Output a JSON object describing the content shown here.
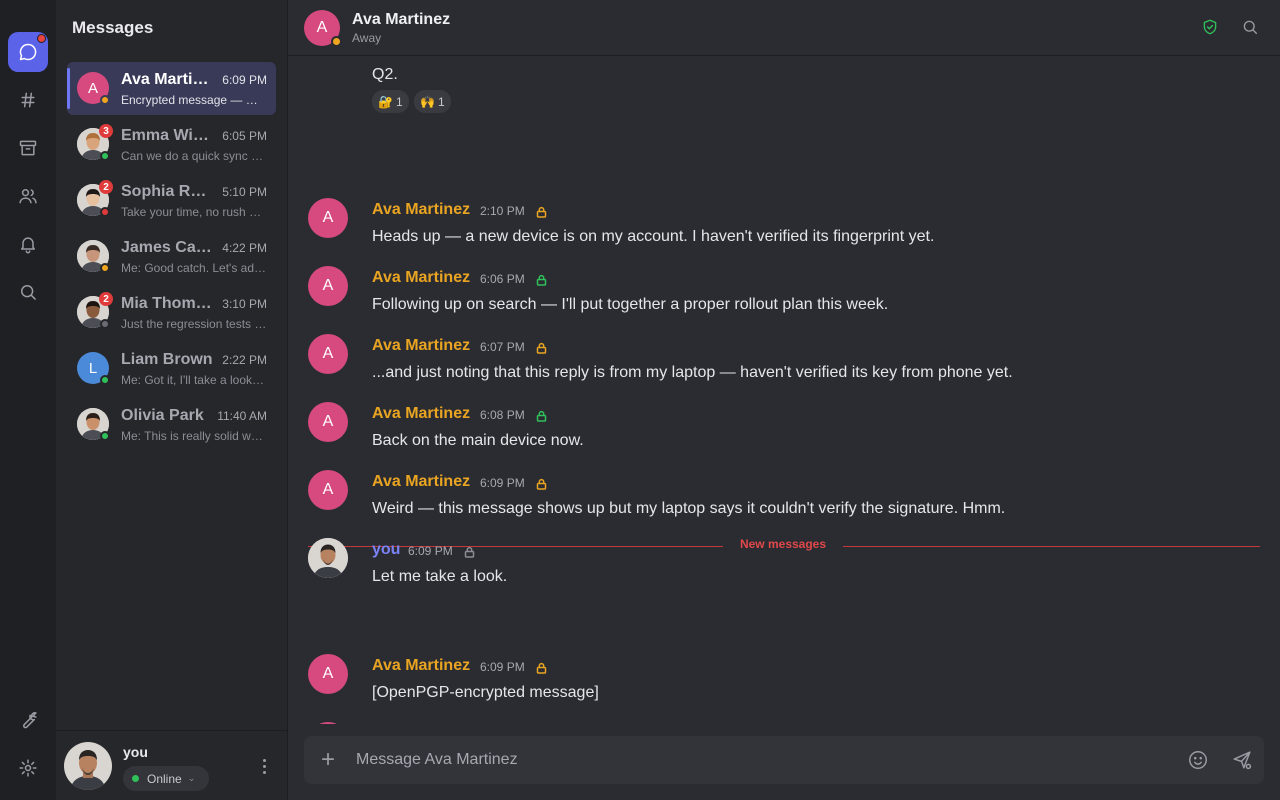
{
  "rail": {
    "items": [
      {
        "icon": "chat-bubble-icon",
        "active": true,
        "has_dot": true
      },
      {
        "icon": "hashtag-icon"
      },
      {
        "icon": "archive-icon"
      },
      {
        "icon": "contacts-icon"
      },
      {
        "icon": "bell-icon"
      },
      {
        "icon": "search-icon"
      }
    ],
    "bottom": [
      {
        "icon": "wrench-icon"
      },
      {
        "icon": "gear-icon"
      }
    ]
  },
  "sidebar": {
    "title": "Messages",
    "conversations": [
      {
        "name": "Ava Martinez",
        "time": "6:09 PM",
        "preview": "Encrypted message — OMEMO not supported",
        "initial": "A",
        "avatar_color": "#d64a7f",
        "presence": "away",
        "active": true
      },
      {
        "name": "Emma Wilson",
        "time": "6:05 PM",
        "preview": "Can we do a quick sync before standup?",
        "unread": "3",
        "presence": "online",
        "photo": true,
        "skin": "#d9a47c",
        "hair": "#b0703c"
      },
      {
        "name": "Sophia Rodriguez",
        "time": "5:10 PM",
        "preview": "Take your time, no rush on the review",
        "unread": "2",
        "presence": "busy",
        "photo": true,
        "skin": "#e6c09f",
        "hair": "#1f1a18"
      },
      {
        "name": "James Carter",
        "time": "4:22 PM",
        "preview": "Me: Good catch. Let's add a test for that",
        "presence": "away",
        "photo": true,
        "skin": "#c6957a",
        "hair": "#3a2c24"
      },
      {
        "name": "Mia Thompson",
        "time": "3:10 PM",
        "preview": "Just the regression tests left to run",
        "unread": "2",
        "presence": "offline",
        "photo": true,
        "skin": "#8a5a3c",
        "hair": "#1c1410"
      },
      {
        "name": "Liam Brown",
        "time": "2:22 PM",
        "preview": "Me: Got it, I'll take a look tonight",
        "initial": "L",
        "avatar_color": "#4a8ad8",
        "presence": "online"
      },
      {
        "name": "Olivia Park",
        "time": "11:40 AM",
        "preview": "Me: This is really solid work",
        "presence": "online",
        "photo": true,
        "skin": "#c9906a",
        "hair": "#2a1e18"
      }
    ],
    "me": {
      "name": "you",
      "status": "Online"
    }
  },
  "header": {
    "name": "Ava Martinez",
    "status": "Away",
    "initial": "A"
  },
  "messages": [
    {
      "continuation": true,
      "text": "Q2.",
      "reactions": [
        {
          "emoji": "🔐",
          "count": "1"
        },
        {
          "emoji": "🙌",
          "count": "1"
        }
      ]
    },
    {
      "sender": "Ava Martinez",
      "initial": "A",
      "time": "2:10 PM",
      "lock": "unverified",
      "text": "Heads up — a new device is on my account. I haven't verified its fingerprint yet."
    },
    {
      "sender": "Ava Martinez",
      "initial": "A",
      "time": "6:06 PM",
      "lock": "verified",
      "text": "Following up on search — I'll put together a proper rollout plan this week."
    },
    {
      "sender": "Ava Martinez",
      "initial": "A",
      "time": "6:07 PM",
      "lock": "unverified",
      "text": "...and just noting that this reply is from my laptop — haven't verified its key from phone yet."
    },
    {
      "sender": "Ava Martinez",
      "initial": "A",
      "time": "6:08 PM",
      "lock": "verified",
      "text": "Back on the main device now."
    },
    {
      "sender": "Ava Martinez",
      "initial": "A",
      "time": "6:09 PM",
      "lock": "unverified",
      "text": "Weird — this message shows up but my laptop says it couldn't verify the signature. Hmm."
    },
    {
      "sender": "you",
      "time": "6:09 PM",
      "lock": "self",
      "text": "Let me take a look.",
      "is_me": true
    },
    {
      "sender": "Ava Martinez",
      "initial": "A",
      "time": "6:09 PM",
      "lock": "unverified",
      "text": "[OpenPGP-encrypted message]"
    },
    {
      "sender": "Ava Martinez",
      "initial": "A",
      "time": "6:09 PM",
      "text": "Encrypted message — OMEMO not supported",
      "system": true
    }
  ],
  "divider": {
    "label": "New messages"
  },
  "composer": {
    "placeholder": "Message Ava Martinez"
  },
  "colors": {
    "accent": "#5b63e8",
    "sender": "#e9a522",
    "me": "#7b82f5",
    "divider": "#e0484a",
    "online": "#2fc15a",
    "away": "#f0a51f",
    "busy": "#e03b3b",
    "verified": "#2fc15a"
  }
}
